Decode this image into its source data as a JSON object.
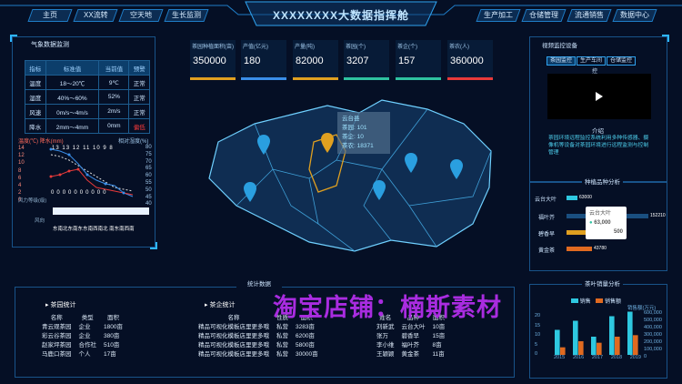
{
  "header": {
    "title": "XXXXXXXX大数据指挥舱",
    "left_tabs": [
      "主页",
      "XX流转",
      "空天地",
      "生长监测"
    ],
    "right_tabs": [
      "生产加工",
      "仓储管理",
      "流通销售",
      "数据中心"
    ]
  },
  "weather": {
    "title": "气象数据监测",
    "columns": [
      "指标",
      "标准值",
      "当前值",
      "预警"
    ],
    "rows": [
      [
        "温度",
        "18～20℃",
        "9℃",
        "正常"
      ],
      [
        "湿度",
        "40%～60%",
        "52%",
        "正常"
      ],
      [
        "风速",
        "0m/s～4m/s",
        "2m/s",
        "正常"
      ],
      [
        "降水",
        "2mm～4mm",
        "0mm",
        "偏低"
      ]
    ]
  },
  "weather_chart": {
    "left_label": "温度(℃) 降水(mm)",
    "right_label": "相对湿度(%)",
    "left_ticks": [
      "14",
      "12",
      "10",
      "8",
      "6",
      "4",
      "2",
      "0"
    ],
    "right_ticks": [
      "80",
      "75",
      "70",
      "65",
      "60",
      "55",
      "50",
      "45",
      "40"
    ],
    "top_labels": [
      "13",
      "13",
      "12",
      "11",
      "10",
      "9",
      "8"
    ],
    "bottom_labels": [
      "0",
      "0",
      "0",
      "0",
      "0",
      "0",
      "0",
      "0",
      "0",
      "0"
    ],
    "x_labels": [
      "东南",
      "北",
      "东南",
      "东",
      "东南",
      "西南",
      "北",
      "南",
      "东南",
      "西南"
    ],
    "x_label_prefix": "风向",
    "wind_label": "风力等级(级)"
  },
  "stats": [
    {
      "label": "茶园种植面积(亩)",
      "value": "350000",
      "color": "#e0a020"
    },
    {
      "label": "产值(亿元)",
      "value": "180",
      "color": "#3a8ee8"
    },
    {
      "label": "产量(吨)",
      "value": "82000",
      "color": "#e0a020"
    },
    {
      "label": "茶园(个)",
      "value": "3207",
      "color": "#2ec2a0"
    },
    {
      "label": "茶企(个)",
      "value": "157",
      "color": "#2ec2a0"
    },
    {
      "label": "茶农(人)",
      "value": "360000",
      "color": "#e83a3a"
    }
  ],
  "map_popup": {
    "title": "云台县",
    "lines": [
      "茶园: 101",
      "茶企: 10",
      "茶农: 18371"
    ]
  },
  "video": {
    "title": "视频监控设备",
    "tabs": [
      "茶园监控",
      "生产车间",
      "仓储监控"
    ],
    "label": "控",
    "intro_title": "介绍",
    "intro_text": "茶园环境远程监控系统利用多种传感器、摄像机等设备对茶园环境进行远程监测与控制管理"
  },
  "varieties": {
    "title": "种植品种分析",
    "names": [
      "云台大叶",
      "福叶芥",
      "碧香早",
      "黄金茶"
    ],
    "tooltip_name": "云台大叶",
    "tooltip_values": [
      "63,000",
      "500"
    ],
    "bar_labels": [
      "63000",
      "152210",
      "43780"
    ]
  },
  "sales": {
    "title": "茶叶销量分析",
    "legend": [
      "销售",
      "销售额"
    ],
    "right_label": "销售额(万元)",
    "left_ticks": [
      "20",
      "15",
      "10",
      "5",
      "0"
    ],
    "right_ticks": [
      "600,000",
      "500,000",
      "400,000",
      "300,000",
      "200,000",
      "100,000",
      "0"
    ],
    "years": [
      "2015",
      "2016",
      "2017",
      "2018",
      "2019"
    ]
  },
  "chart_data": {
    "type": "bar",
    "categories": [
      "2015",
      "2016",
      "2017",
      "2018",
      "2019"
    ],
    "series": [
      {
        "name": "销售",
        "values": [
          11,
          15,
          8,
          17,
          19
        ]
      },
      {
        "name": "销售额",
        "values": [
          100000,
          180000,
          160000,
          240000,
          260000
        ]
      }
    ],
    "ylabel": "销售额(万元)",
    "ylim": [
      0,
      20
    ]
  },
  "stats_section": {
    "title": "统计数据",
    "garden_title": "茶园统计",
    "enterprise_title": "茶企统计",
    "garden_cols": [
      "名称",
      "类型",
      "面积"
    ],
    "garden_rows": [
      [
        "青云观茶园",
        "企业",
        "1800亩"
      ],
      [
        "彩云谷茶园",
        "企业",
        "380亩"
      ],
      [
        "赵家坪茶园",
        "合作社",
        "510亩"
      ],
      [
        "马鹿口茶园",
        "个人",
        "17亩"
      ]
    ],
    "ent_cols": [
      "名称",
      "性质",
      "面积"
    ],
    "ent_rows": [
      [
        "精品可视化模板店里更多哦",
        "私营",
        "3283亩"
      ],
      [
        "精品可视化模板店里更多哦",
        "私营",
        "6200亩"
      ],
      [
        "精品可视化模板店里更多哦",
        "私营",
        "5800亩"
      ],
      [
        "精品可视化模板店里更多哦",
        "私营",
        "30000亩"
      ]
    ],
    "farmer_cols": [
      "姓名",
      "品种",
      "面积"
    ],
    "farmer_rows": [
      [
        "刘新武",
        "云台大叶",
        "10亩"
      ],
      [
        "张万",
        "碧香早",
        "15亩"
      ],
      [
        "李小维",
        "福叶芥",
        "8亩"
      ],
      [
        "王颖颖",
        "黄金茶",
        "11亩"
      ]
    ]
  },
  "watermark": "淘宝店铺：楠斯素材"
}
